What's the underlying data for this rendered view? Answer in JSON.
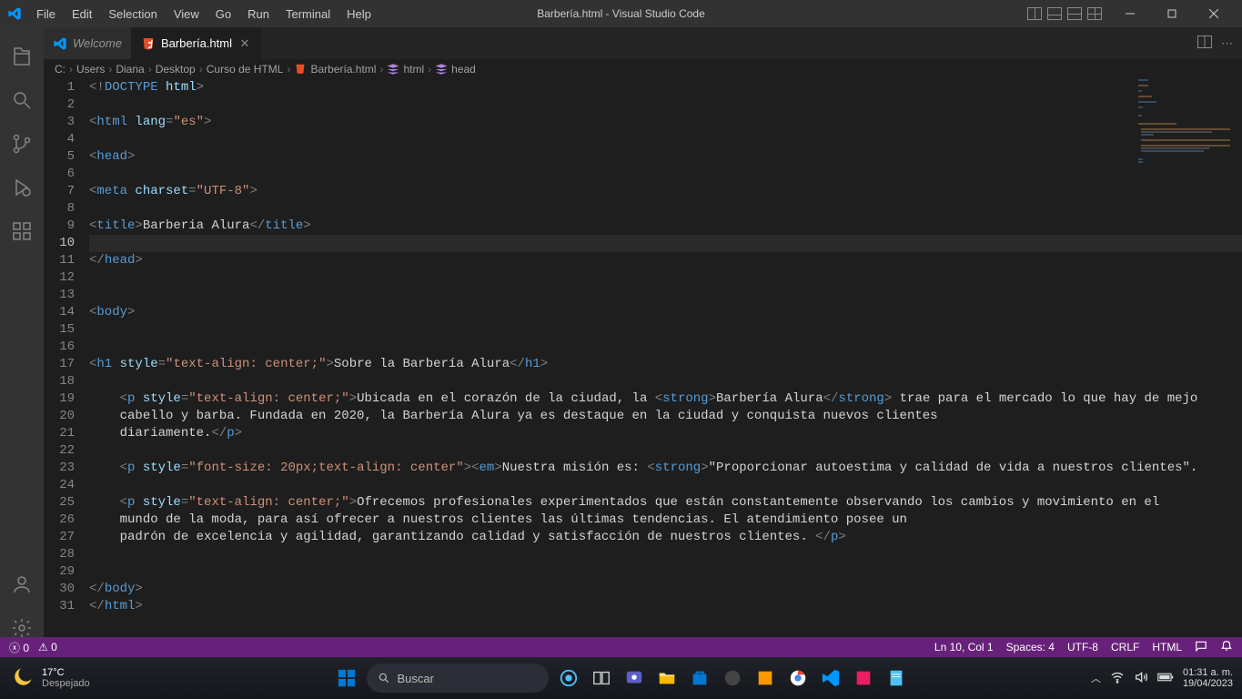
{
  "titlebar": {
    "menu": [
      "File",
      "Edit",
      "Selection",
      "View",
      "Go",
      "Run",
      "Terminal",
      "Help"
    ],
    "title": "Barbería.html - Visual Studio Code"
  },
  "tabs": [
    {
      "label": "Welcome",
      "active": false
    },
    {
      "label": "Barbería.html",
      "active": true
    }
  ],
  "breadcrumbs": {
    "segments": [
      "C:",
      "Users",
      "Diana",
      "Desktop",
      "Curso de HTML",
      "Barbería.html",
      "html",
      "head"
    ]
  },
  "editor": {
    "current_line": 10,
    "lines": [
      {
        "n": 1,
        "tokens": [
          [
            "<!",
            "gray"
          ],
          [
            "DOCTYPE",
            "blue"
          ],
          [
            " ",
            "text"
          ],
          [
            "html",
            "lblue"
          ],
          [
            ">",
            "gray"
          ]
        ]
      },
      {
        "n": 2,
        "tokens": []
      },
      {
        "n": 3,
        "tokens": [
          [
            "<",
            "gray"
          ],
          [
            "html",
            "blue"
          ],
          [
            " ",
            "text"
          ],
          [
            "lang",
            "lblue"
          ],
          [
            "=",
            "gray"
          ],
          [
            "\"es\"",
            "str"
          ],
          [
            ">",
            "gray"
          ]
        ]
      },
      {
        "n": 4,
        "tokens": []
      },
      {
        "n": 5,
        "tokens": [
          [
            "<",
            "gray"
          ],
          [
            "head",
            "blue"
          ],
          [
            ">",
            "gray"
          ]
        ]
      },
      {
        "n": 6,
        "tokens": []
      },
      {
        "n": 7,
        "tokens": [
          [
            "<",
            "gray"
          ],
          [
            "meta",
            "blue"
          ],
          [
            " ",
            "text"
          ],
          [
            "charset",
            "lblue"
          ],
          [
            "=",
            "gray"
          ],
          [
            "\"UTF-8\"",
            "str"
          ],
          [
            ">",
            "gray"
          ]
        ]
      },
      {
        "n": 8,
        "tokens": []
      },
      {
        "n": 9,
        "tokens": [
          [
            "<",
            "gray"
          ],
          [
            "title",
            "blue"
          ],
          [
            ">",
            "gray"
          ],
          [
            "Barberia Alura",
            "text"
          ],
          [
            "</",
            "gray"
          ],
          [
            "title",
            "blue"
          ],
          [
            ">",
            "gray"
          ]
        ]
      },
      {
        "n": 10,
        "tokens": []
      },
      {
        "n": 11,
        "tokens": [
          [
            "</",
            "gray"
          ],
          [
            "head",
            "blue"
          ],
          [
            ">",
            "gray"
          ]
        ]
      },
      {
        "n": 12,
        "tokens": []
      },
      {
        "n": 13,
        "tokens": []
      },
      {
        "n": 14,
        "tokens": [
          [
            "<",
            "gray"
          ],
          [
            "body",
            "blue"
          ],
          [
            ">",
            "gray"
          ]
        ]
      },
      {
        "n": 15,
        "tokens": []
      },
      {
        "n": 16,
        "tokens": []
      },
      {
        "n": 17,
        "tokens": [
          [
            "<",
            "gray"
          ],
          [
            "h1",
            "blue"
          ],
          [
            " ",
            "text"
          ],
          [
            "style",
            "lblue"
          ],
          [
            "=",
            "gray"
          ],
          [
            "\"text-align: center;\"",
            "str"
          ],
          [
            ">",
            "gray"
          ],
          [
            "Sobre la Barbería Alura",
            "text"
          ],
          [
            "</",
            "gray"
          ],
          [
            "h1",
            "blue"
          ],
          [
            ">",
            "gray"
          ]
        ]
      },
      {
        "n": 18,
        "tokens": []
      },
      {
        "n": 19,
        "indent": 1,
        "tokens": [
          [
            "<",
            "gray"
          ],
          [
            "p",
            "blue"
          ],
          [
            " ",
            "text"
          ],
          [
            "style",
            "lblue"
          ],
          [
            "=",
            "gray"
          ],
          [
            "\"text-align: center;\"",
            "str"
          ],
          [
            ">",
            "gray"
          ],
          [
            "Ubicada en el corazón de la ciudad, la ",
            "text"
          ],
          [
            "<",
            "gray"
          ],
          [
            "strong",
            "blue"
          ],
          [
            ">",
            "gray"
          ],
          [
            "Barbería Alura",
            "text"
          ],
          [
            "</",
            "gray"
          ],
          [
            "strong",
            "blue"
          ],
          [
            ">",
            "gray"
          ],
          [
            " trae para el mercado lo que hay de mejo",
            "text"
          ]
        ]
      },
      {
        "n": 20,
        "indent": 1,
        "tokens": [
          [
            "cabello y barba. Fundada en 2020, la Barbería Alura ya es destaque en la ciudad y conquista nuevos clientes",
            "text"
          ]
        ]
      },
      {
        "n": 21,
        "indent": 1,
        "tokens": [
          [
            "diariamente.",
            "text"
          ],
          [
            "</",
            "gray"
          ],
          [
            "p",
            "blue"
          ],
          [
            ">",
            "gray"
          ]
        ]
      },
      {
        "n": 22,
        "tokens": []
      },
      {
        "n": 23,
        "indent": 1,
        "tokens": [
          [
            "<",
            "gray"
          ],
          [
            "p",
            "blue"
          ],
          [
            " ",
            "text"
          ],
          [
            "style",
            "lblue"
          ],
          [
            "=",
            "gray"
          ],
          [
            "\"font-size: 20px;text-align: center\"",
            "str"
          ],
          [
            "><",
            "gray"
          ],
          [
            "em",
            "blue"
          ],
          [
            ">",
            "gray"
          ],
          [
            "Nuestra misión es: ",
            "text"
          ],
          [
            "<",
            "gray"
          ],
          [
            "strong",
            "blue"
          ],
          [
            ">",
            "gray"
          ],
          [
            "\"Proporcionar autoestima y calidad de vida a nuestros clientes\".",
            "text"
          ]
        ]
      },
      {
        "n": 24,
        "tokens": []
      },
      {
        "n": 25,
        "indent": 1,
        "tokens": [
          [
            "<",
            "gray"
          ],
          [
            "p",
            "blue"
          ],
          [
            " ",
            "text"
          ],
          [
            "style",
            "lblue"
          ],
          [
            "=",
            "gray"
          ],
          [
            "\"text-align: center;\"",
            "str"
          ],
          [
            ">",
            "gray"
          ],
          [
            "Ofrecemos profesionales experimentados que están constantemente observando los cambios y movimiento en el",
            "text"
          ]
        ]
      },
      {
        "n": 26,
        "indent": 1,
        "tokens": [
          [
            "mundo de la moda, para así ofrecer a nuestros clientes las últimas tendencias. El atendimiento posee un",
            "text"
          ]
        ]
      },
      {
        "n": 27,
        "indent": 1,
        "tokens": [
          [
            "padrón de excelencia y agilidad, garantizando calidad y satisfacción de nuestros clientes. ",
            "text"
          ],
          [
            "</",
            "gray"
          ],
          [
            "p",
            "blue"
          ],
          [
            ">",
            "gray"
          ]
        ]
      },
      {
        "n": 28,
        "tokens": []
      },
      {
        "n": 29,
        "tokens": []
      },
      {
        "n": 30,
        "tokens": [
          [
            "</",
            "gray"
          ],
          [
            "body",
            "blue"
          ],
          [
            ">",
            "gray"
          ]
        ]
      },
      {
        "n": 31,
        "tokens": [
          [
            "</",
            "gray"
          ],
          [
            "html",
            "blue"
          ],
          [
            ">",
            "gray"
          ]
        ]
      }
    ]
  },
  "status": {
    "errors": "0",
    "warnings": "0",
    "position": "Ln 10, Col 1",
    "spaces": "Spaces: 4",
    "encoding": "UTF-8",
    "eol": "CRLF",
    "lang": "HTML"
  },
  "taskbar": {
    "weather_temp": "17°C",
    "weather_desc": "Despejado",
    "search_placeholder": "Buscar",
    "clock_time": "01:31 a. m.",
    "clock_date": "19/04/2023"
  }
}
